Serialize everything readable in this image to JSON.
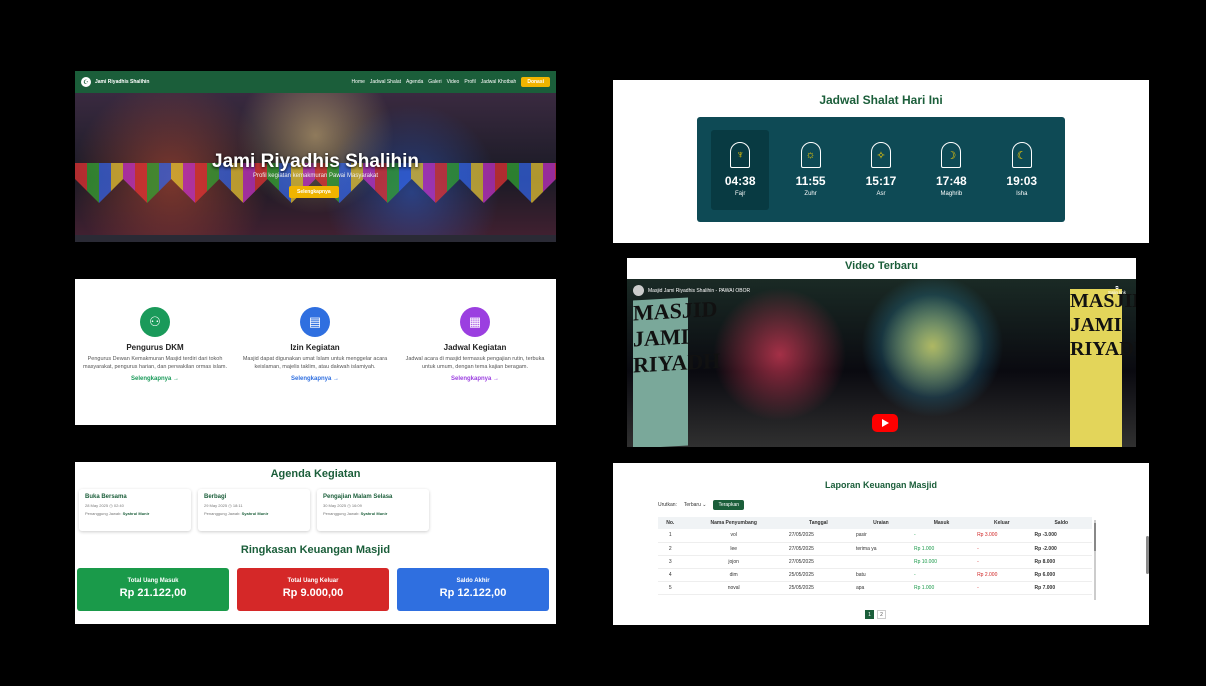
{
  "hero": {
    "brand": "Jami Riyadhis Shalihin",
    "menu": [
      "Home",
      "Jadwal Shalat",
      "Agenda",
      "Galeri",
      "Video",
      "Profil",
      "Jadwal Khotbah"
    ],
    "donate_label": "Donasi",
    "title": "Jami Riyadhis Shalihin",
    "subtitle": "Profil kegiatan kemakmuran Pawai Masyarakat",
    "cta_label": "Selengkapnya"
  },
  "jadwal": {
    "title": "Jadwal Shalat Hari Ini",
    "prayers": [
      {
        "time": "04:38",
        "name": "Fajr",
        "icon": "mosque-icon",
        "active": true
      },
      {
        "time": "11:55",
        "name": "Zuhr",
        "icon": "sun-icon",
        "active": false
      },
      {
        "time": "15:17",
        "name": "Asr",
        "icon": "sun-low-icon",
        "active": false
      },
      {
        "time": "17:48",
        "name": "Maghrib",
        "icon": "sunset-moon-icon",
        "active": false
      },
      {
        "time": "19:03",
        "name": "Isha",
        "icon": "moon-icon",
        "active": false
      }
    ]
  },
  "services": [
    {
      "title": "Pengurus DKM",
      "desc": "Pengurus Dewan Kemakmuran Masjid terdiri dari tokoh masyarakat, pengurus harian, dan perwakilan ormas islam.",
      "link": "Selengkapnya →",
      "color": "#1a9a5a",
      "icon": "people-icon"
    },
    {
      "title": "Izin Kegiatan",
      "desc": "Masjid dapat digunakan umat Islam untuk menggelar acara keislaman, majelis taklim, atau dakwah islamiyah.",
      "link": "Selengkapnya →",
      "color": "#2f6fe0",
      "icon": "document-icon"
    },
    {
      "title": "Jadwal Kegiatan",
      "desc": "Jadwal acara di masjid termasuk pengajian rutin, terbuka untuk umum, dengan tema kajian beragam.",
      "link": "Selengkapnya →",
      "color": "#9b3fe0",
      "icon": "calendar-icon"
    }
  ],
  "video": {
    "title": "Video Terbaru",
    "channel_title": "Masjid Jami Riyadhis Shalihin - PAWAI OBOR",
    "share_label": "Salin link",
    "banner_left": "MASJID JAMI RIYADH",
    "banner_right": "MASJID JAMI RIYADH"
  },
  "agenda": {
    "title": "Agenda Kegiatan",
    "items": [
      {
        "title": "Buka Bersama",
        "meta": "28 May 2025  ◷ 02:40",
        "pj_label": "Penanggung Jawab:",
        "pj": "Syahrul Munir"
      },
      {
        "title": "Berbagi",
        "meta": "29 May 2025  ◷ 18:11",
        "pj_label": "Penanggung Jawab:",
        "pj": "Syahrul Munir"
      },
      {
        "title": "Pengajian Malam Selasa",
        "meta": "30 May 2025  ◷ 16:09",
        "pj_label": "Penanggung Jawab:",
        "pj": "Syahrul Munir"
      }
    ]
  },
  "ringkasan": {
    "title": "Ringkasan Keuangan Masjid",
    "cards": [
      {
        "label": "Total Uang Masuk",
        "value": "Rp 21.122,00",
        "color": "#1a9a4a"
      },
      {
        "label": "Total Uang Keluar",
        "value": "Rp 9.000,00",
        "color": "#d52828"
      },
      {
        "label": "Saldo Akhir",
        "value": "Rp 12.122,00",
        "color": "#2f6fe0"
      }
    ]
  },
  "laporan": {
    "title": "Laporan Keuangan Masjid",
    "sort_label": "Urutkan:",
    "sort_value": "Terbaru",
    "apply_label": "Terapkan",
    "columns": [
      "No.",
      "Nama Penyumbang",
      "Tanggal",
      "Uraian",
      "Masuk",
      "Keluar",
      "Saldo"
    ],
    "rows": [
      [
        "1",
        "vol",
        "27/05/2025",
        "pasir",
        "-",
        "Rp 3.000",
        "Rp -3.000"
      ],
      [
        "2",
        "lee",
        "27/05/2025",
        "terima ya",
        "Rp 1.000",
        "-",
        "Rp -2.000"
      ],
      [
        "3",
        "jojon",
        "27/05/2025",
        "",
        "Rp 10.000",
        "-",
        "Rp 8.000"
      ],
      [
        "4",
        "dim",
        "25/05/2025",
        "batu",
        "-",
        "Rp 2.000",
        "Rp 6.000"
      ],
      [
        "5",
        "noval",
        "25/05/2025",
        "apa",
        "Rp 1.000",
        "-",
        "Rp 7.000"
      ]
    ],
    "pages": [
      "1",
      "2"
    ]
  }
}
